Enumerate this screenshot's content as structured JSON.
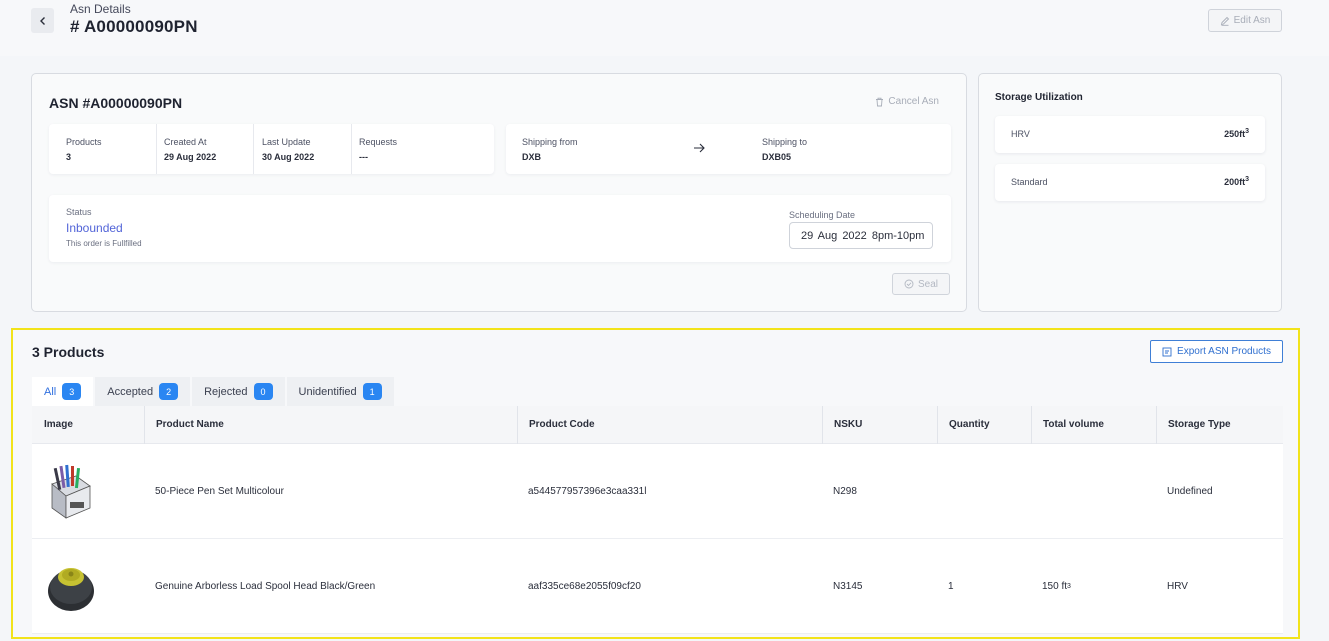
{
  "header": {
    "breadcrumb": "Asn Details",
    "title": "# A00000090PN",
    "edit_label": "Edit Asn"
  },
  "asn": {
    "title": "ASN #A00000090PN",
    "cancel_label": "Cancel Asn",
    "info": [
      {
        "label": "Products",
        "value": "3"
      },
      {
        "label": "Created At",
        "value": "29 Aug 2022"
      },
      {
        "label": "Last Update",
        "value": "30 Aug 2022"
      },
      {
        "label": "Requests",
        "value": "---"
      }
    ],
    "shipping_from": {
      "label": "Shipping from",
      "value": "DXB"
    },
    "shipping_to": {
      "label": "Shipping to",
      "value": "DXB05"
    },
    "status": {
      "label": "Status",
      "value": "Inbounded",
      "note": "This order is Fullfilled"
    },
    "scheduling": {
      "label": "Scheduling Date",
      "value": "29 Aug 2022   8pm-10pm"
    },
    "seal_label": "Seal"
  },
  "storage": {
    "title": "Storage Utilization",
    "items": [
      {
        "name": "HRV",
        "value": "250ft",
        "sup": "3"
      },
      {
        "name": "Standard",
        "value": "200ft",
        "sup": "3"
      }
    ]
  },
  "products": {
    "title": "3 Products",
    "export_label": "Export ASN Products",
    "tabs": [
      {
        "label": "All",
        "count": "3"
      },
      {
        "label": "Accepted",
        "count": "2"
      },
      {
        "label": "Rejected",
        "count": "0"
      },
      {
        "label": "Unidentified",
        "count": "1"
      }
    ],
    "columns": [
      "Image",
      "Product Name",
      "Product Code",
      "NSKU",
      "Quantity",
      "Total volume",
      "Storage Type"
    ],
    "rows": [
      {
        "name": "50-Piece Pen Set Multicolour",
        "code": "a544577957396e3caa331l",
        "nsku": "N298",
        "quantity": "",
        "volume": "",
        "volume_sup": "",
        "storage": "Undefined"
      },
      {
        "name": "Genuine Arborless Load Spool Head Black/Green",
        "code": "aaf335ce68e2055f09cf20",
        "nsku": "N3145",
        "quantity": "1",
        "volume": "150 ft",
        "volume_sup": "3",
        "storage": "HRV"
      }
    ]
  },
  "colors": {
    "accent": "#2a86f2",
    "status": "#5264d8",
    "highlight": "#f2e31a"
  }
}
